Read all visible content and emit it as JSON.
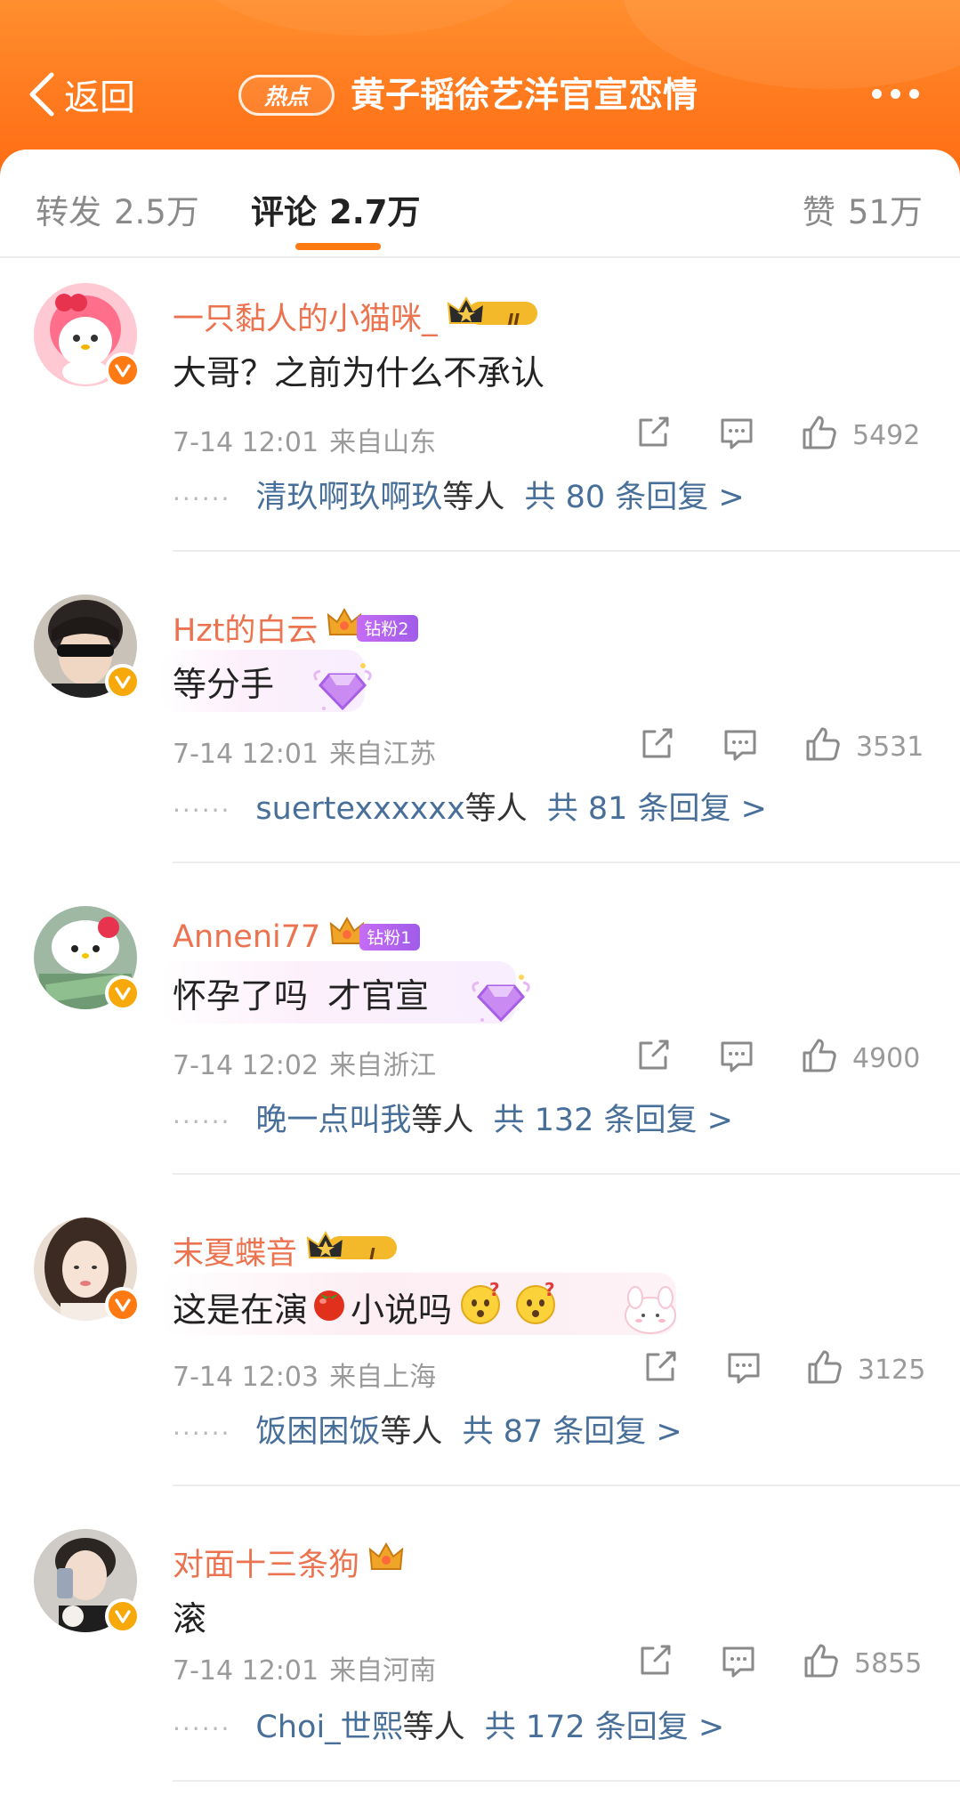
{
  "header": {
    "back_label": "返回",
    "hot_badge": "热点",
    "topic_title": "黄子韬徐艺洋官宣恋情",
    "accent_color": "#ff7a1e"
  },
  "tabs": {
    "repost_label": "转发",
    "repost_count": "2.5万",
    "comment_label": "评论",
    "comment_count": "2.7万",
    "like_label": "赞",
    "like_count": "51万"
  },
  "comments": [
    {
      "username": "一只黏人的小猫咪_",
      "badge": "crown-level-II",
      "crown_level": "II",
      "text": "大哥？之前为什么不承认",
      "time": "7-14 12:01",
      "location": "来自山东",
      "likes": "5492",
      "reply_users": "清玖啊玖啊玖",
      "reply_etc": "等人",
      "reply_total": "共 80 条回复 >"
    },
    {
      "username": "Hzt的白云",
      "badge": "fan-tag",
      "fan_tag": "钻粉2",
      "text": "等分手",
      "time": "7-14 12:01",
      "location": "来自江苏",
      "likes": "3531",
      "reply_users": "suertexxxxxx",
      "reply_etc": "等人",
      "reply_total": "共 81 条回复 >"
    },
    {
      "username": "Anneni77",
      "badge": "fan-tag",
      "fan_tag": "钻粉1",
      "text_a": "怀孕了吗",
      "text_b": "才官宣",
      "time": "7-14 12:02",
      "location": "来自浙江",
      "likes": "4900",
      "reply_users": "晚一点叫我",
      "reply_etc": "等人",
      "reply_total": "共 132 条回复 >"
    },
    {
      "username": "末夏蝶音",
      "badge": "crown-level-I",
      "crown_level": "I",
      "text_a": "这是在演",
      "text_b": "小说吗",
      "time": "7-14 12:03",
      "location": "来自上海",
      "likes": "3125",
      "reply_users": "饭困困饭",
      "reply_etc": "等人",
      "reply_total": "共 87 条回复 >"
    },
    {
      "username": "对面十三条狗",
      "badge": "crown",
      "text": "滚",
      "time": "7-14 12:01",
      "location": "来自河南",
      "likes": "5855",
      "reply_users": "Choi_世熙",
      "reply_etc": "等人",
      "reply_total": "共 172 条回复 >"
    }
  ]
}
